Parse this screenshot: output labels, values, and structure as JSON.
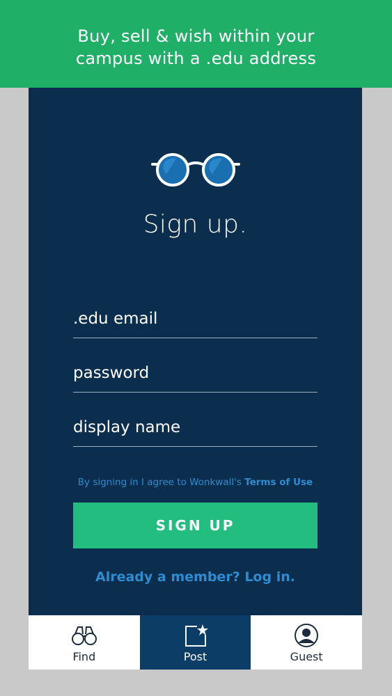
{
  "promo": {
    "line1": "Buy, sell & wish within your",
    "line2": "campus with a .edu address"
  },
  "logo": {
    "icon": "glasses-icon"
  },
  "title": "Sign up.",
  "form": {
    "email_placeholder": ".edu email",
    "password_placeholder": "password",
    "display_name_placeholder": "display name"
  },
  "terms": {
    "prefix": "By signing in I agree to Wonkwall's ",
    "link": "Terms of Use"
  },
  "signup_button": "SIGN UP",
  "login_link": "Already a member? Log in.",
  "tabs": [
    {
      "label": "Find",
      "icon": "binoculars-icon",
      "active": false
    },
    {
      "label": "Post",
      "icon": "post-star-icon",
      "active": true
    },
    {
      "label": "Guest",
      "icon": "user-avatar-icon",
      "active": false
    }
  ],
  "colors": {
    "promo_bg": "#1faf67",
    "panel_bg": "#0b2e4e",
    "button_bg": "#22bd7f",
    "link": "#2f8ccf",
    "active_tab": "#0b3d66"
  }
}
